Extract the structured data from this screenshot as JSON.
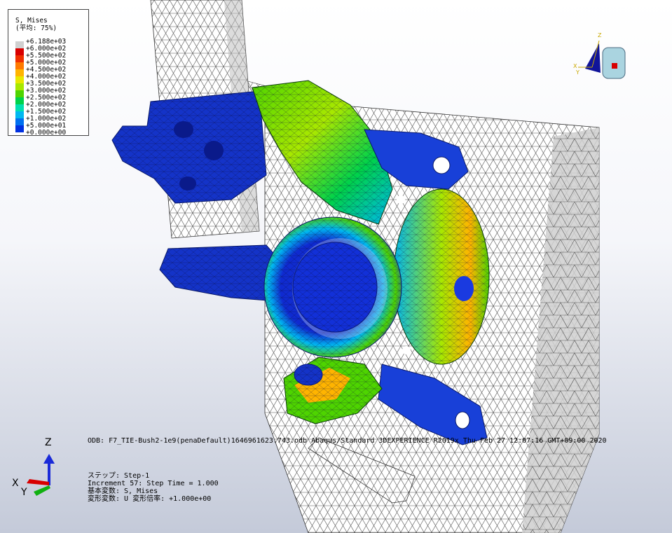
{
  "legend": {
    "title_line1": "S, Mises",
    "title_line2": "(平均: 75%)",
    "entries": [
      {
        "value": "+6.188e+03",
        "color": "#d0d0d0"
      },
      {
        "value": "+6.000e+02",
        "color": "#d90000"
      },
      {
        "value": "+5.500e+02",
        "color": "#f03000"
      },
      {
        "value": "+5.000e+02",
        "color": "#ff7a00"
      },
      {
        "value": "+4.500e+02",
        "color": "#ffb400"
      },
      {
        "value": "+4.000e+02",
        "color": "#e8e800"
      },
      {
        "value": "+3.500e+02",
        "color": "#a8e800"
      },
      {
        "value": "+3.000e+02",
        "color": "#4ed400"
      },
      {
        "value": "+2.500e+02",
        "color": "#00d24a"
      },
      {
        "value": "+2.000e+02",
        "color": "#00e0b0"
      },
      {
        "value": "+1.500e+02",
        "color": "#00b8f0"
      },
      {
        "value": "+1.000e+02",
        "color": "#0070f0"
      },
      {
        "value": "+5.000e+01",
        "color": "#0030e0"
      },
      {
        "value": "+0.000e+00",
        "color": "#1010b8"
      }
    ]
  },
  "odb_line": "ODB: F7_TIE-Bush2-1e9(penaDefault)1646961623.743.odb    Abaqus/Standard 3DEXPERIENCE R2019x    Thu Feb 27 12:07:16 GMT+09:00 2020",
  "step_info": {
    "step": "ステップ: Step-1",
    "increment": "Increment     57: Step Time =    1.000",
    "primary_var": "基本変数: S, Mises",
    "deformed_var": "変形変数: U   変形倍率: +1.000e+00"
  },
  "triad": {
    "z": "Z",
    "x": "X",
    "y": "Y"
  },
  "view_cube": {
    "z": "Z",
    "x": "X",
    "y": "Y"
  }
}
